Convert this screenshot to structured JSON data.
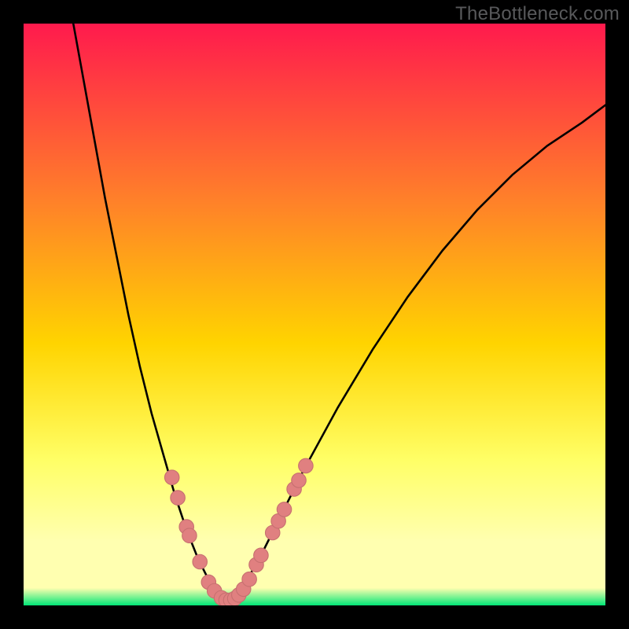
{
  "watermark": "TheBottleneck.com",
  "colors": {
    "frame": "#000000",
    "grad_top": "#ff1a4d",
    "grad_mid1": "#ff7f2a",
    "grad_mid2": "#ffd400",
    "grad_mid3": "#ffff66",
    "grad_low": "#ffffb0",
    "grad_bottom": "#00e676",
    "curve": "#000000",
    "marker_fill": "#e08080",
    "marker_stroke": "#c77070"
  },
  "chart_data": {
    "type": "line",
    "title": "",
    "xlabel": "",
    "ylabel": "",
    "xlim": [
      0,
      100
    ],
    "ylim": [
      0,
      100
    ],
    "curve_left": [
      {
        "x": 8,
        "y": 103
      },
      {
        "x": 10,
        "y": 92
      },
      {
        "x": 12,
        "y": 81
      },
      {
        "x": 14,
        "y": 70
      },
      {
        "x": 16,
        "y": 60
      },
      {
        "x": 18,
        "y": 50
      },
      {
        "x": 20,
        "y": 41
      },
      {
        "x": 22,
        "y": 33
      },
      {
        "x": 24,
        "y": 26
      },
      {
        "x": 26,
        "y": 19
      },
      {
        "x": 28,
        "y": 13
      },
      {
        "x": 30,
        "y": 8
      },
      {
        "x": 32,
        "y": 4
      },
      {
        "x": 34,
        "y": 1.5
      },
      {
        "x": 35,
        "y": 0.8
      }
    ],
    "curve_right": [
      {
        "x": 35,
        "y": 0.8
      },
      {
        "x": 37,
        "y": 2.5
      },
      {
        "x": 40,
        "y": 7
      },
      {
        "x": 44,
        "y": 15
      },
      {
        "x": 48,
        "y": 23
      },
      {
        "x": 54,
        "y": 34
      },
      {
        "x": 60,
        "y": 44
      },
      {
        "x": 66,
        "y": 53
      },
      {
        "x": 72,
        "y": 61
      },
      {
        "x": 78,
        "y": 68
      },
      {
        "x": 84,
        "y": 74
      },
      {
        "x": 90,
        "y": 79
      },
      {
        "x": 96,
        "y": 83
      },
      {
        "x": 100,
        "y": 86
      }
    ],
    "markers": [
      {
        "x": 25.5,
        "y": 22
      },
      {
        "x": 26.5,
        "y": 18.5
      },
      {
        "x": 28.0,
        "y": 13.5
      },
      {
        "x": 28.5,
        "y": 12
      },
      {
        "x": 30.3,
        "y": 7.5
      },
      {
        "x": 31.8,
        "y": 4
      },
      {
        "x": 32.8,
        "y": 2.5
      },
      {
        "x": 34.0,
        "y": 1.3
      },
      {
        "x": 34.8,
        "y": 0.9
      },
      {
        "x": 35.6,
        "y": 0.9
      },
      {
        "x": 36.3,
        "y": 1.2
      },
      {
        "x": 37.0,
        "y": 1.8
      },
      {
        "x": 37.8,
        "y": 2.8
      },
      {
        "x": 38.8,
        "y": 4.5
      },
      {
        "x": 40.0,
        "y": 7.0
      },
      {
        "x": 40.8,
        "y": 8.6
      },
      {
        "x": 42.8,
        "y": 12.5
      },
      {
        "x": 43.8,
        "y": 14.5
      },
      {
        "x": 44.8,
        "y": 16.5
      },
      {
        "x": 46.5,
        "y": 20
      },
      {
        "x": 47.3,
        "y": 21.5
      },
      {
        "x": 48.5,
        "y": 24
      }
    ]
  }
}
